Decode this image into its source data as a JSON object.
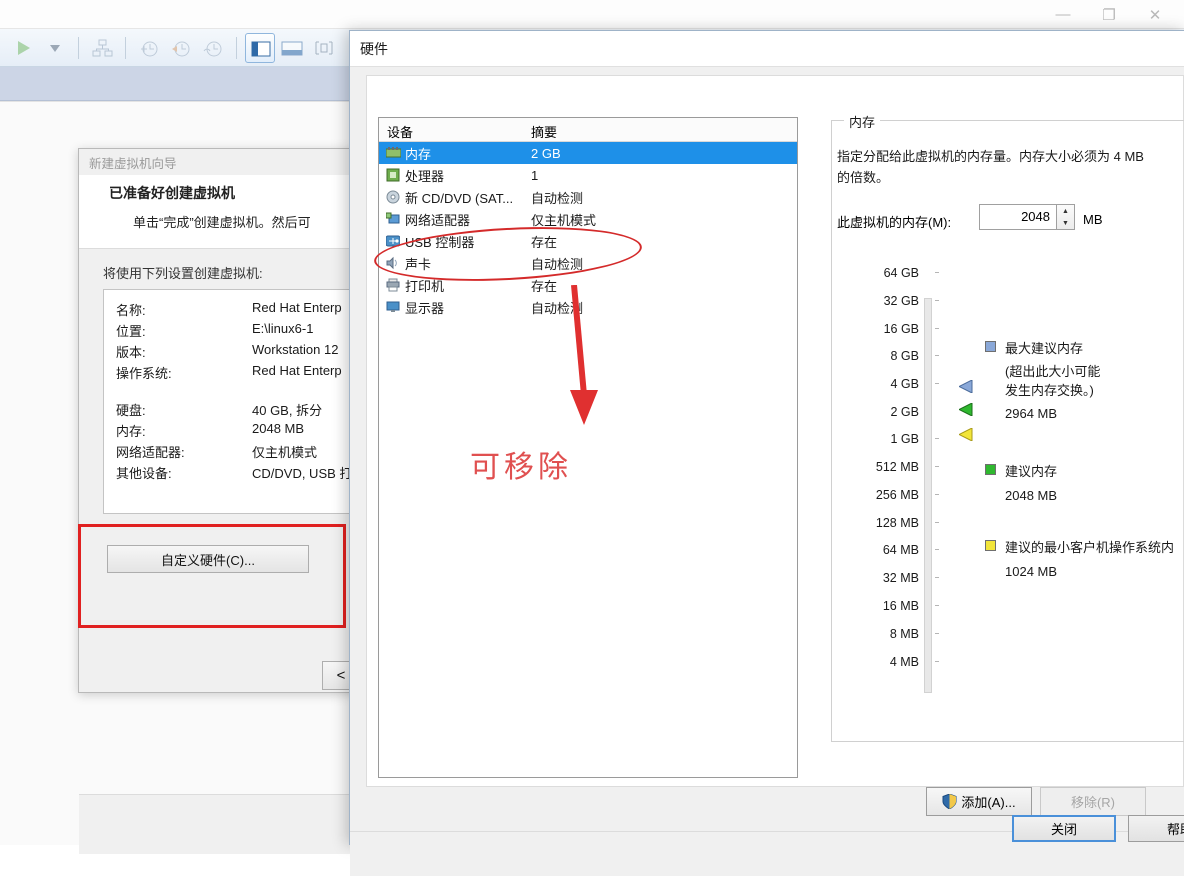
{
  "main_window": {
    "controls": [
      {
        "name": "minimize",
        "glyph": "—"
      },
      {
        "name": "restore",
        "glyph": "❐"
      },
      {
        "name": "close",
        "glyph": "✕"
      }
    ],
    "toolbar": [
      {
        "name": "power-on-button",
        "icon": "play-icon"
      },
      {
        "name": "power-dropdown",
        "icon": "chevron-down-icon"
      },
      {
        "name": "manage-snapshots-button",
        "icon": "snapshot-manager-icon"
      },
      {
        "name": "take-snapshot-button",
        "icon": "snapshot-add-icon"
      },
      {
        "name": "revert-snapshot-button",
        "icon": "snapshot-revert-icon"
      },
      {
        "name": "snapshot-manager-button",
        "icon": "snapshot-settings-icon"
      },
      {
        "name": "show-library-button",
        "icon": "library-panel-icon"
      },
      {
        "name": "show-console-button",
        "icon": "console-view-icon"
      },
      {
        "name": "fullscreen-button",
        "icon": "fullscreen-icon"
      }
    ]
  },
  "wizard": {
    "title": "新建虚拟机向导",
    "heading": "已准备好创建虚拟机",
    "subheading": "单击“完成”创建虚拟机。然后可",
    "intro": "将使用下列设置创建虚拟机:",
    "summary": [
      {
        "key": "名称:",
        "value": "Red Hat Enterp"
      },
      {
        "key": "位置:",
        "value": "E:\\linux6-1"
      },
      {
        "key": "版本:",
        "value": "Workstation 12"
      },
      {
        "key": "操作系统:",
        "value": "Red Hat Enterp"
      },
      {
        "key": "硬盘:",
        "value": "40 GB, 拆分"
      },
      {
        "key": "内存:",
        "value": "2048 MB"
      },
      {
        "key": "网络适配器:",
        "value": "仅主机模式"
      },
      {
        "key": "其他设备:",
        "value": "CD/DVD, USB 打"
      }
    ],
    "custom_hardware_button": "自定义硬件(C)...",
    "back_button": "<"
  },
  "hardware_dialog": {
    "title": "硬件",
    "table": {
      "columns": [
        "设备",
        "摘要"
      ],
      "rows": [
        {
          "device": "内存",
          "summary": "2 GB",
          "icon": "memory-icon",
          "selected": true
        },
        {
          "device": "处理器",
          "summary": "1",
          "icon": "processor-icon",
          "selected": false
        },
        {
          "device": "新 CD/DVD (SAT...",
          "summary": "自动检测",
          "icon": "cddvd-icon",
          "selected": false
        },
        {
          "device": "网络适配器",
          "summary": "仅主机模式",
          "icon": "network-adapter-icon",
          "selected": false
        },
        {
          "device": "USB 控制器",
          "summary": "存在",
          "icon": "usb-controller-icon",
          "selected": false
        },
        {
          "device": "声卡",
          "summary": "自动检测",
          "icon": "sound-card-icon",
          "selected": false
        },
        {
          "device": "打印机",
          "summary": "存在",
          "icon": "printer-icon",
          "selected": false
        },
        {
          "device": "显示器",
          "summary": "自动检测",
          "icon": "display-icon",
          "selected": false
        }
      ]
    },
    "annotation": {
      "note_text": "可移除",
      "note_color": "#e05050",
      "ellipse_color": "#d42a2a",
      "rect_color": "#e02020"
    },
    "memory_panel": {
      "group_label": "内存",
      "description": "指定分配给此虚拟机的内存量。内存大小必须为 4 MB\n的倍数。",
      "field_label": "此虚拟机的内存(M):",
      "field_value": "2048",
      "unit": "MB",
      "scale": [
        "64 GB",
        "32 GB",
        "16 GB",
        "8 GB",
        "4 GB",
        "2 GB",
        "1 GB",
        "512 MB",
        "256 MB",
        "128 MB",
        "64 MB",
        "32 MB",
        "16 MB",
        "8 MB",
        "4 MB"
      ],
      "current_scale_position": "2 GB",
      "legend": [
        {
          "swatch": "#8aa8d8",
          "title": "最大建议内存",
          "note": "(超出此大小可能\n发生内存交换。)",
          "value": "2964 MB"
        },
        {
          "swatch": "#2fb82f",
          "title": "建议内存",
          "note": "",
          "value": "2048 MB"
        },
        {
          "swatch": "#f2e53a",
          "title": "建议的最小客户机操作系统内",
          "note": "",
          "value": "1024 MB"
        }
      ]
    },
    "buttons": {
      "add": "添加(A)...",
      "remove": "移除(R)",
      "close": "关闭",
      "help": "帮助"
    }
  }
}
